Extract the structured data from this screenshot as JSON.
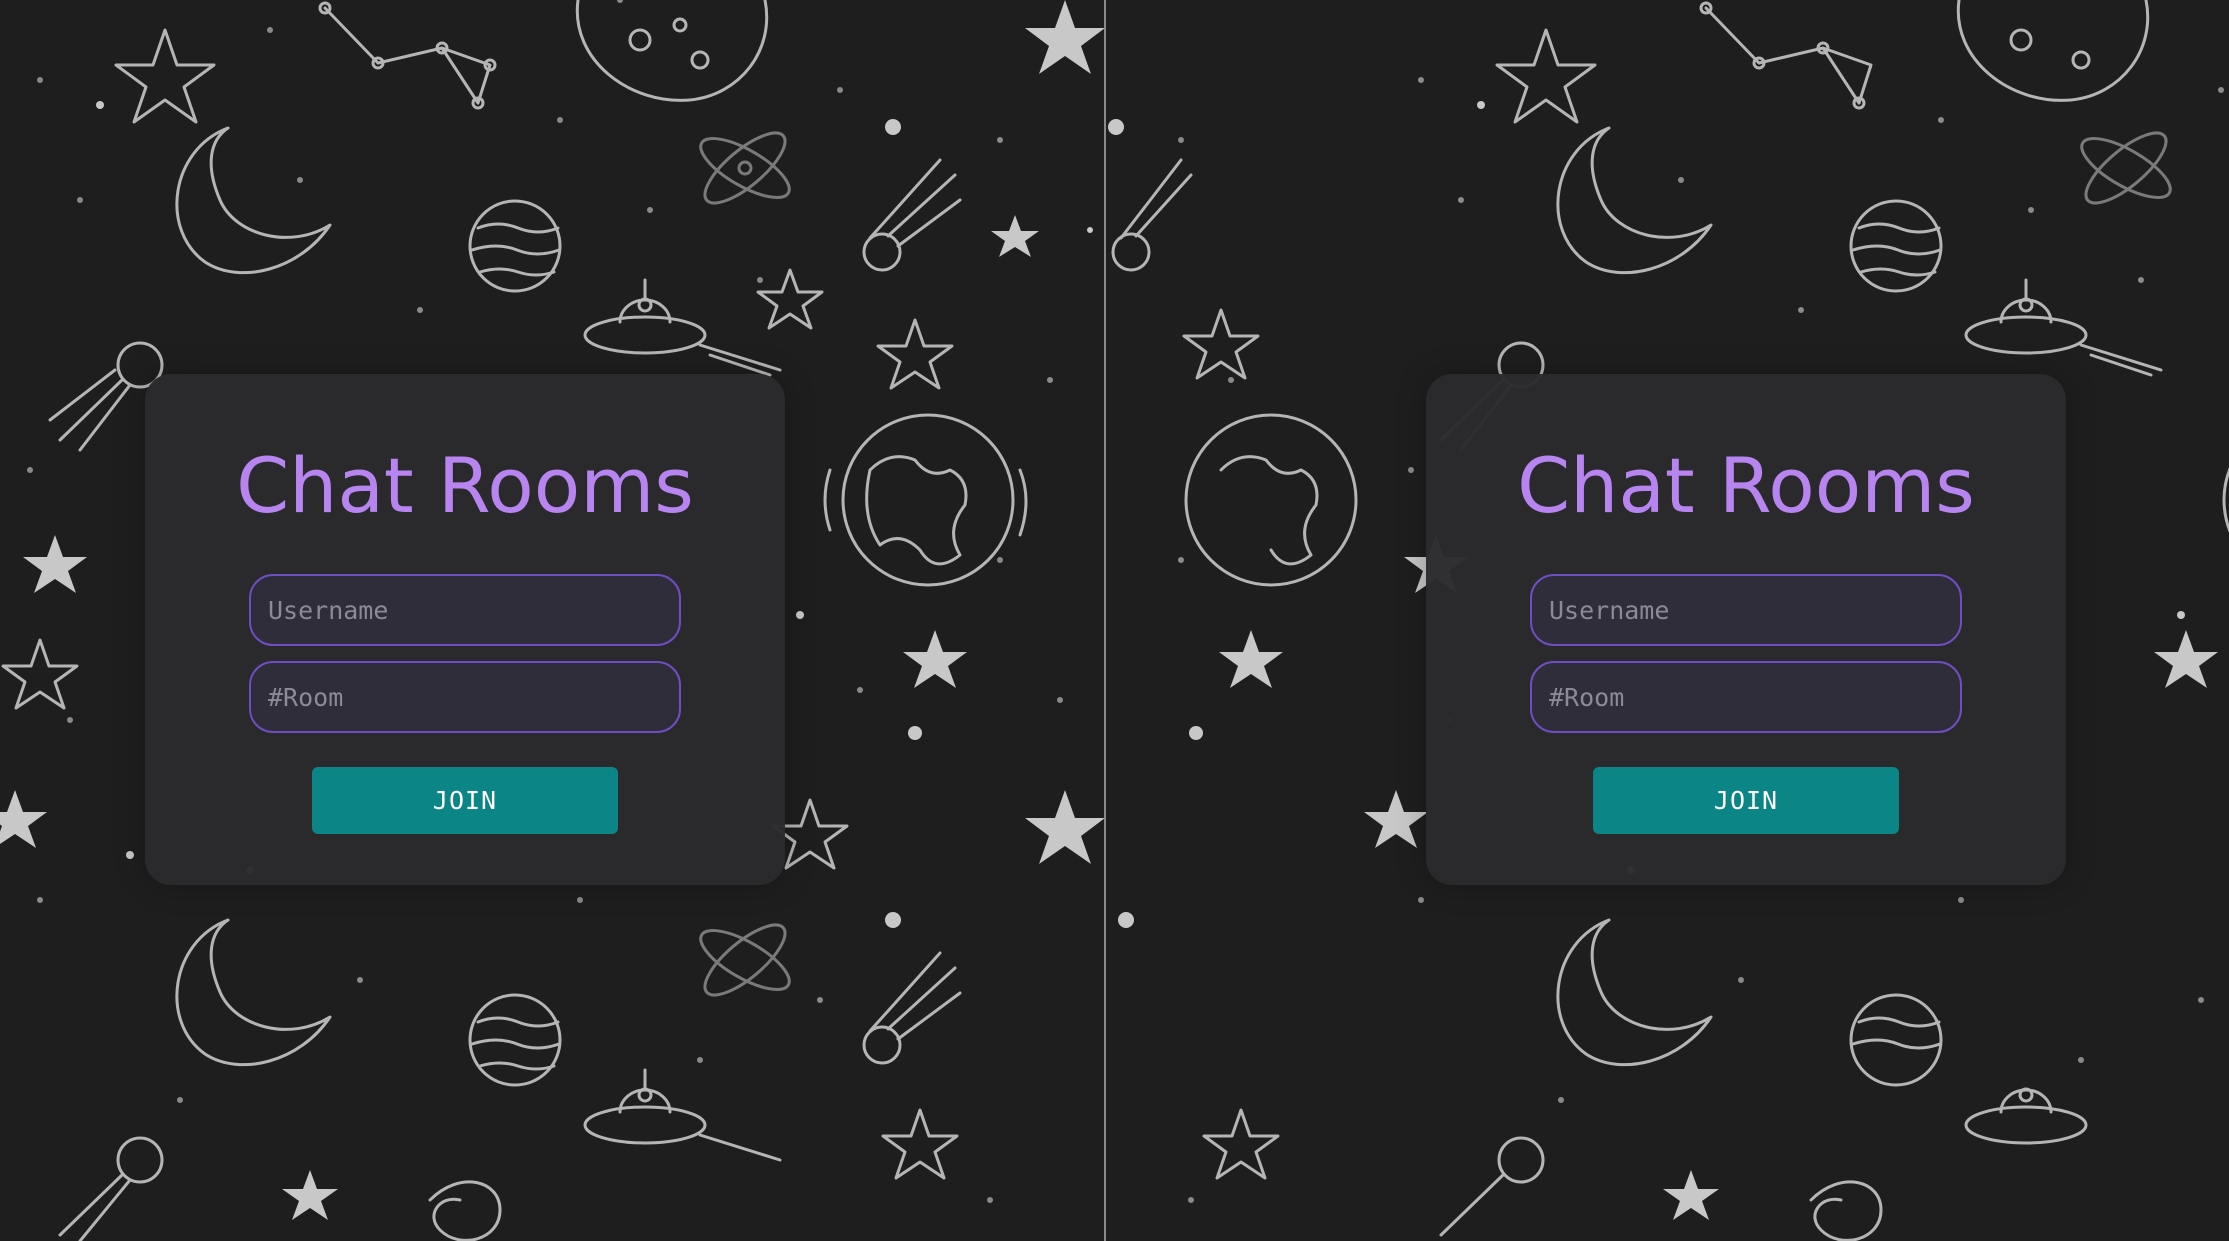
{
  "panels": [
    {
      "title": "Chat Rooms",
      "username_placeholder": "Username",
      "room_placeholder": "#Room",
      "join_label": "JOIN"
    },
    {
      "title": "Chat Rooms",
      "username_placeholder": "Username",
      "room_placeholder": "#Room",
      "join_label": "JOIN"
    }
  ],
  "colors": {
    "background": "#1e1e1e",
    "card": "#2a2a2c",
    "title": "#b784f0",
    "input_border": "#6f4ec4",
    "input_background": "#2f2d3a",
    "button": "#0b8585",
    "doodles": "#bdbdbd"
  },
  "background_icons": [
    "star-icon",
    "moon-icon",
    "planet-icon",
    "earth-icon",
    "ufo-icon",
    "comet-icon",
    "constellation-icon",
    "atom-icon",
    "satellite-icon",
    "galaxy-icon"
  ]
}
